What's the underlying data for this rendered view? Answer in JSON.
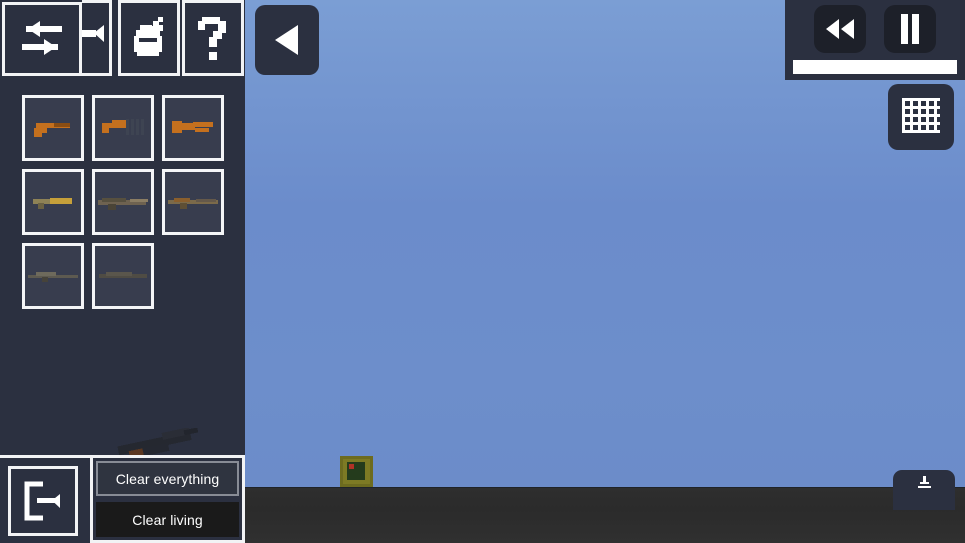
{
  "app": {
    "title": "Sandbox Weapon Spawner",
    "sidebar_bg": "#2b3040",
    "accent": "#f2f3f5",
    "sky_color": "#6b8ccb",
    "ground_color": "#2e2e2e"
  },
  "toolbar": {
    "items": [
      {
        "name": "swap-tool",
        "icon": "swap-arrows-icon",
        "label": "Swap"
      },
      {
        "name": "arrow-tool",
        "icon": "arrow-right-icon",
        "label": "Move"
      },
      {
        "name": "grenade-tool",
        "icon": "grenade-icon",
        "label": "Grenade"
      },
      {
        "name": "help-tool",
        "icon": "question-mark-icon",
        "label": "Help"
      }
    ]
  },
  "item_grid": {
    "rows": [
      [
        {
          "name": "weapon-slot-pistol",
          "label": "Pistol",
          "type": "pistol",
          "tint": "#c46a1e"
        },
        {
          "name": "weapon-slot-smg",
          "label": "SMG",
          "type": "smg",
          "tint": "#c46a1e"
        },
        {
          "name": "weapon-slot-sawnoff",
          "label": "Sawn-off Shotgun",
          "type": "sawnoff",
          "tint": "#c46a1e"
        }
      ],
      [
        {
          "name": "weapon-slot-carbine",
          "label": "Carbine",
          "type": "carbine",
          "tint": "#9a8a5a"
        },
        {
          "name": "weapon-slot-rifle",
          "label": "Assault Rifle",
          "type": "rifle",
          "tint": "#6e6250"
        },
        {
          "name": "weapon-slot-ak",
          "label": "AK Rifle",
          "type": "ak",
          "tint": "#7b6a4a"
        }
      ],
      [
        {
          "name": "weapon-slot-sniper",
          "label": "Sniper Rifle",
          "type": "sniper",
          "tint": "#5d5a50"
        },
        {
          "name": "weapon-slot-lmg",
          "label": "Machine Gun",
          "type": "lmg",
          "tint": "#4f4c44"
        }
      ]
    ]
  },
  "bottom_bar": {
    "exit": {
      "name": "exit-button",
      "icon": "exit-door-icon",
      "label": "Exit"
    },
    "clear_everything": "Clear everything",
    "clear_living": "Clear living"
  },
  "hud": {
    "back_button": {
      "name": "back-button",
      "icon": "triangle-left-icon",
      "label": "Back"
    },
    "rewind_button": {
      "name": "rewind-button",
      "icon": "rewind-icon",
      "label": "Rewind"
    },
    "pause_button": {
      "name": "pause-button",
      "icon": "pause-icon",
      "label": "Pause"
    },
    "timeline": {
      "name": "timeline-bar",
      "value": 100,
      "label": "Timeline"
    },
    "grid_button": {
      "name": "grid-button",
      "icon": "grid-icon",
      "label": "Grid"
    },
    "download_button": {
      "name": "download-button",
      "icon": "download-icon",
      "label": "Download"
    }
  },
  "world": {
    "entity": {
      "name": "world-entity-crate",
      "label": "Spawned object"
    },
    "held_weapon": {
      "name": "held-weapon-sprite",
      "label": "Held weapon"
    }
  }
}
